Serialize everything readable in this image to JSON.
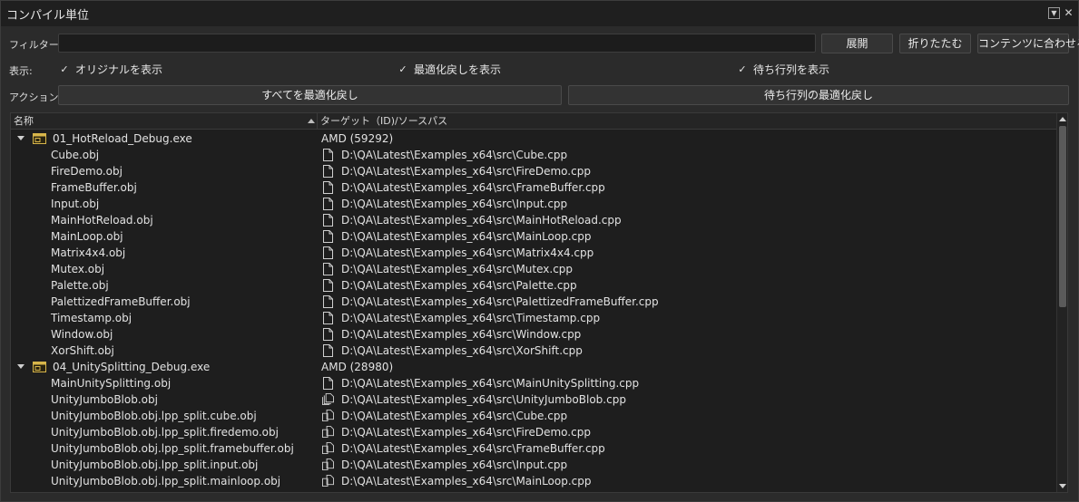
{
  "window": {
    "title": "コンパイル単位"
  },
  "filter": {
    "label": "フィルター:",
    "value": "",
    "expand_label": "展開",
    "collapse_label": "折りたたむ",
    "fit_label": "コンテンツに合わせる"
  },
  "display": {
    "label": "表示:",
    "show_original": "オリジナルを表示",
    "show_deopt": "最適化戻しを表示",
    "show_queue": "待ち行列を表示"
  },
  "actions": {
    "label": "アクション:",
    "deopt_all": "すべてを最適化戻し",
    "deopt_queue": "待ち行列の最適化戻し"
  },
  "table": {
    "columns": [
      "名称",
      "ターゲット（ID)/ソースパス"
    ],
    "rows": [
      {
        "kind": "exe",
        "name": "01_HotReload_Debug.exe",
        "target": "AMD (59292)"
      },
      {
        "kind": "obj",
        "icon": "file",
        "name": "Cube.obj",
        "target": "D:\\QA\\Latest\\Examples_x64\\src\\Cube.cpp"
      },
      {
        "kind": "obj",
        "icon": "file",
        "name": "FireDemo.obj",
        "target": "D:\\QA\\Latest\\Examples_x64\\src\\FireDemo.cpp"
      },
      {
        "kind": "obj",
        "icon": "file",
        "name": "FrameBuffer.obj",
        "target": "D:\\QA\\Latest\\Examples_x64\\src\\FrameBuffer.cpp"
      },
      {
        "kind": "obj",
        "icon": "file",
        "name": "Input.obj",
        "target": "D:\\QA\\Latest\\Examples_x64\\src\\Input.cpp"
      },
      {
        "kind": "obj",
        "icon": "file",
        "name": "MainHotReload.obj",
        "target": "D:\\QA\\Latest\\Examples_x64\\src\\MainHotReload.cpp"
      },
      {
        "kind": "obj",
        "icon": "file",
        "name": "MainLoop.obj",
        "target": "D:\\QA\\Latest\\Examples_x64\\src\\MainLoop.cpp"
      },
      {
        "kind": "obj",
        "icon": "file",
        "name": "Matrix4x4.obj",
        "target": "D:\\QA\\Latest\\Examples_x64\\src\\Matrix4x4.cpp"
      },
      {
        "kind": "obj",
        "icon": "file",
        "name": "Mutex.obj",
        "target": "D:\\QA\\Latest\\Examples_x64\\src\\Mutex.cpp"
      },
      {
        "kind": "obj",
        "icon": "file",
        "name": "Palette.obj",
        "target": "D:\\QA\\Latest\\Examples_x64\\src\\Palette.cpp"
      },
      {
        "kind": "obj",
        "icon": "file",
        "name": "PalettizedFrameBuffer.obj",
        "target": "D:\\QA\\Latest\\Examples_x64\\src\\PalettizedFrameBuffer.cpp"
      },
      {
        "kind": "obj",
        "icon": "file",
        "name": "Timestamp.obj",
        "target": "D:\\QA\\Latest\\Examples_x64\\src\\Timestamp.cpp"
      },
      {
        "kind": "obj",
        "icon": "file",
        "name": "Window.obj",
        "target": "D:\\QA\\Latest\\Examples_x64\\src\\Window.cpp"
      },
      {
        "kind": "obj",
        "icon": "file",
        "name": "XorShift.obj",
        "target": "D:\\QA\\Latest\\Examples_x64\\src\\XorShift.cpp"
      },
      {
        "kind": "exe",
        "name": "04_UnitySplitting_Debug.exe",
        "target": "AMD (28980)"
      },
      {
        "kind": "obj",
        "icon": "file",
        "name": "MainUnitySplitting.obj",
        "target": "D:\\QA\\Latest\\Examples_x64\\src\\MainUnitySplitting.cpp"
      },
      {
        "kind": "obj",
        "icon": "multi-file",
        "name": "UnityJumboBlob.obj",
        "target": "D:\\QA\\Latest\\Examples_x64\\src\\UnityJumboBlob.cpp"
      },
      {
        "kind": "obj",
        "icon": "split-file",
        "name": "UnityJumboBlob.obj.lpp_split.cube.obj",
        "target": "D:\\QA\\Latest\\Examples_x64\\src\\Cube.cpp"
      },
      {
        "kind": "obj",
        "icon": "split-file",
        "name": "UnityJumboBlob.obj.lpp_split.firedemo.obj",
        "target": "D:\\QA\\Latest\\Examples_x64\\src\\FireDemo.cpp"
      },
      {
        "kind": "obj",
        "icon": "split-file",
        "name": "UnityJumboBlob.obj.lpp_split.framebuffer.obj",
        "target": "D:\\QA\\Latest\\Examples_x64\\src\\FrameBuffer.cpp"
      },
      {
        "kind": "obj",
        "icon": "split-file",
        "name": "UnityJumboBlob.obj.lpp_split.input.obj",
        "target": "D:\\QA\\Latest\\Examples_x64\\src\\Input.cpp"
      },
      {
        "kind": "obj",
        "icon": "split-file",
        "name": "UnityJumboBlob.obj.lpp_split.mainloop.obj",
        "target": "D:\\QA\\Latest\\Examples_x64\\src\\MainLoop.cpp"
      }
    ]
  }
}
